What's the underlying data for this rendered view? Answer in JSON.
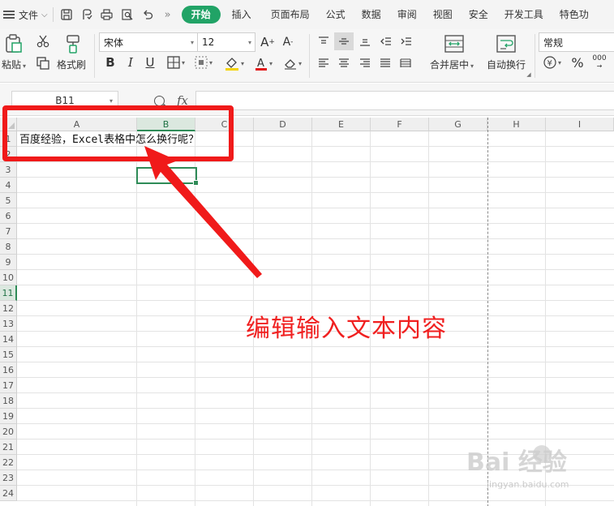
{
  "menubar": {
    "file_label": "文件",
    "tabs": [
      {
        "label": "开始",
        "active": true
      },
      {
        "label": "插入"
      },
      {
        "label": "页面布局"
      },
      {
        "label": "公式"
      },
      {
        "label": "数据"
      },
      {
        "label": "审阅"
      },
      {
        "label": "视图"
      },
      {
        "label": "安全"
      },
      {
        "label": "开发工具"
      },
      {
        "label": "特色功"
      }
    ],
    "overflow": "»"
  },
  "ribbon": {
    "paste_label": "粘贴",
    "format_painter_label": "格式刷",
    "font_name": "宋体",
    "font_size": "12",
    "merge_center_label": "合并居中",
    "wrap_text_label": "自动换行",
    "number_format": "常规",
    "percent": "%",
    "thousands": "000",
    "bold": "B",
    "italic": "I",
    "underline": "U",
    "grow_font": "A⁺",
    "shrink_font": "A⁻",
    "font_color_letter": "A"
  },
  "formula_bar": {
    "name_box": "B11",
    "fx": "fx",
    "content": ""
  },
  "sheet": {
    "columns": [
      "A",
      "B",
      "C",
      "D",
      "E",
      "F",
      "G",
      "H",
      "I"
    ],
    "rows": [
      "1",
      "2",
      "3",
      "4",
      "5",
      "6",
      "7",
      "8",
      "9",
      "10",
      "11",
      "12",
      "13",
      "14",
      "15",
      "16",
      "17",
      "18",
      "19",
      "20",
      "21",
      "22",
      "23",
      "24"
    ],
    "selected_column": "B",
    "selected_row": "11",
    "cell_a1": "百度经验，Excel表格中怎么换行呢？"
  },
  "annotation": {
    "caption": "编辑输入文本内容",
    "color": "#f01a1a"
  },
  "watermark": {
    "brand": "Bai 经验",
    "url": "jingyan.baidu.com"
  },
  "colors": {
    "accent": "#21a366",
    "selection": "#2e8b57"
  }
}
